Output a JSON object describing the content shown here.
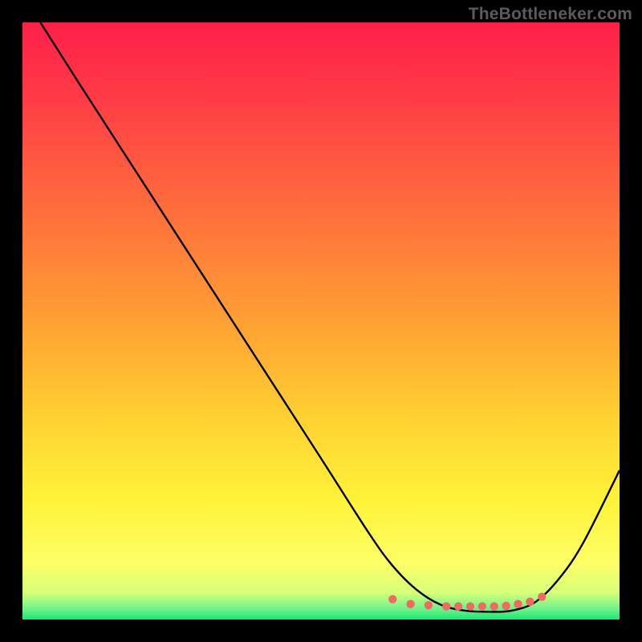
{
  "watermark": "TheBottleneker.com",
  "chart_data": {
    "type": "line",
    "title": "",
    "xlabel": "",
    "ylabel": "",
    "xlim": [
      0,
      100
    ],
    "ylim": [
      0,
      100
    ],
    "grid": false,
    "series": [
      {
        "name": "curve",
        "color": "#000000",
        "x": [
          3,
          10,
          20,
          30,
          40,
          50,
          58,
          62,
          66,
          70,
          74,
          78,
          82,
          86,
          90,
          94,
          100
        ],
        "y": [
          100,
          89,
          73.5,
          58,
          42.5,
          27,
          14.5,
          9,
          5,
          2.5,
          1.5,
          1.3,
          1.5,
          3,
          7,
          13,
          25
        ]
      },
      {
        "name": "markers",
        "color": "#ef6b62",
        "as_dots": true,
        "x": [
          62,
          65,
          68,
          71,
          73,
          75,
          77,
          79,
          81,
          83,
          85,
          87
        ],
        "y": [
          3.4,
          2.6,
          2.4,
          2.2,
          2.2,
          2.2,
          2.2,
          2.2,
          2.3,
          2.6,
          3.0,
          3.8
        ]
      }
    ],
    "background_gradient": {
      "stops": [
        {
          "offset": 0.0,
          "color": "#ff1f4a"
        },
        {
          "offset": 0.12,
          "color": "#ff3a46"
        },
        {
          "offset": 0.3,
          "color": "#ff6a3d"
        },
        {
          "offset": 0.48,
          "color": "#ff9a34"
        },
        {
          "offset": 0.66,
          "color": "#ffd031"
        },
        {
          "offset": 0.8,
          "color": "#fff338"
        },
        {
          "offset": 0.905,
          "color": "#fdff66"
        },
        {
          "offset": 0.955,
          "color": "#d7ff7a"
        },
        {
          "offset": 0.985,
          "color": "#63f08a"
        },
        {
          "offset": 1.0,
          "color": "#19e76e"
        }
      ]
    }
  }
}
